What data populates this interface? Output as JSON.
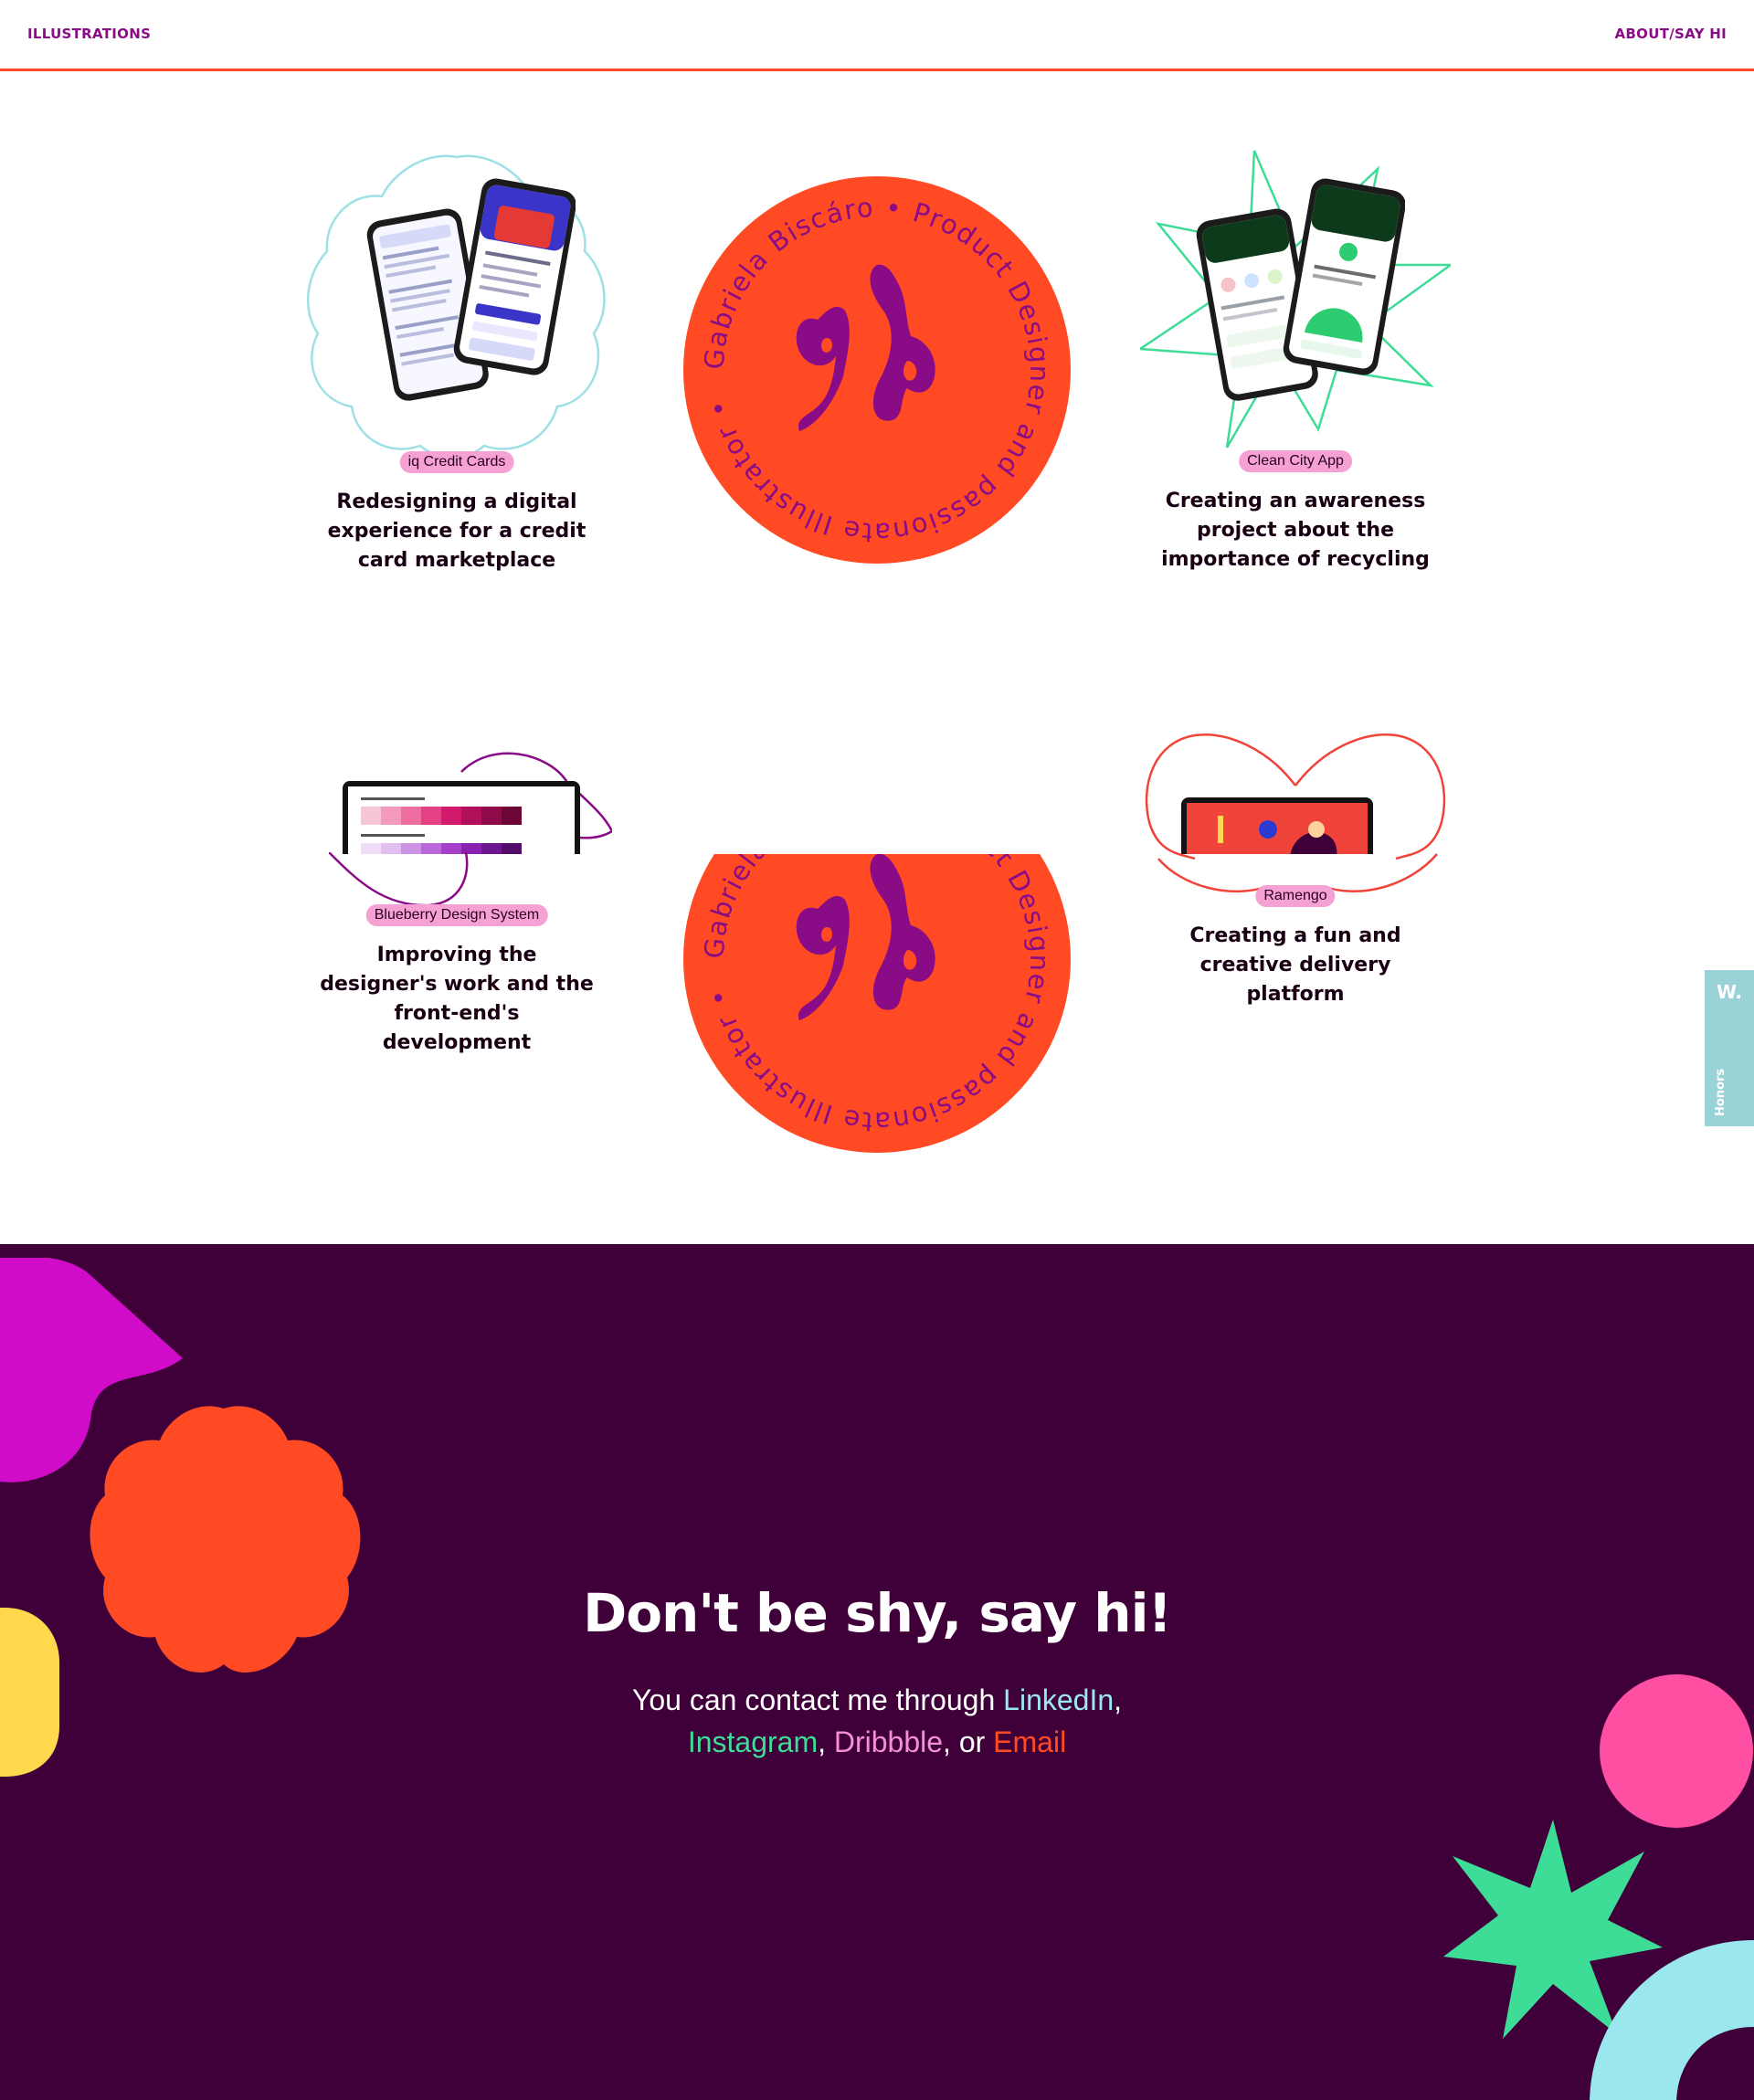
{
  "nav": {
    "left_label": "ILLUSTRATIONS",
    "right_label": "ABOUT/SAY HI"
  },
  "colors": {
    "accent_orange": "#ff4a23",
    "brand_purple": "#8a0b86",
    "tag_pink": "#f5a1d3",
    "footer_bg": "#3f003a",
    "side_tab": "#9ad3d7"
  },
  "badge": {
    "text": "Gabriela Biscáro • Product Designer and passionate Illustrator •",
    "logo_icon": "gb-monogram-icon"
  },
  "projects": [
    {
      "tag": "iq Credit Cards",
      "title_lines": [
        "Redesigning a digital",
        "experience for a credit",
        "card marketplace"
      ],
      "frame_icon": "scalloped-outline-icon"
    },
    {
      "tag": "Clean City App",
      "title_lines": [
        "Creating an awareness",
        "project about the",
        "importance of recycling"
      ],
      "frame_icon": "star-burst-outline-icon"
    },
    {
      "tag": "Blueberry Design System",
      "title_lines": [
        "Improving the",
        "designer's work and the",
        "front-end's",
        "development"
      ],
      "frame_icon": "blob-outline-icon"
    },
    {
      "tag": "Ramengo",
      "title_lines": [
        "Creating a fun and",
        "creative delivery",
        "platform"
      ],
      "frame_icon": "infinity-outline-icon"
    }
  ],
  "side_tab": {
    "logo": "W.",
    "label": "Honors"
  },
  "footer": {
    "title": "Don't be shy, say hi!",
    "intro": "You can contact me through ",
    "linkedin": "LinkedIn",
    "sep1": ",",
    "instagram": "Instagram",
    "sep2": ", ",
    "dribbble": "Dribbble",
    "sep3": ", or ",
    "email": "Email"
  }
}
